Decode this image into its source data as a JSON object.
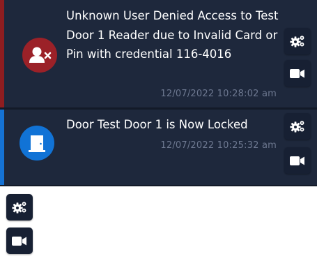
{
  "events": [
    {
      "message": "Unknown User Denied Access to Test Door 1 Reader due to Invalid Card or Pin with credential 116-4016",
      "timestamp": "12/07/2022 10:28:02 am",
      "status_color": "#8e1d20",
      "icon": "user-denied-icon",
      "icon_color": "#9b2128"
    },
    {
      "message": "Door Test Door 1 is Now Locked",
      "timestamp": "12/07/2022 10:25:32 am",
      "status_color": "#1572d4",
      "icon": "door-icon",
      "icon_color": "#1173d6"
    }
  ],
  "actions": {
    "settings_icon": "gears-icon",
    "camera_icon": "video-camera-icon"
  },
  "colors": {
    "panel_background": "#1e283c",
    "button_background": "#172033",
    "timestamp_text": "#6d7890"
  }
}
